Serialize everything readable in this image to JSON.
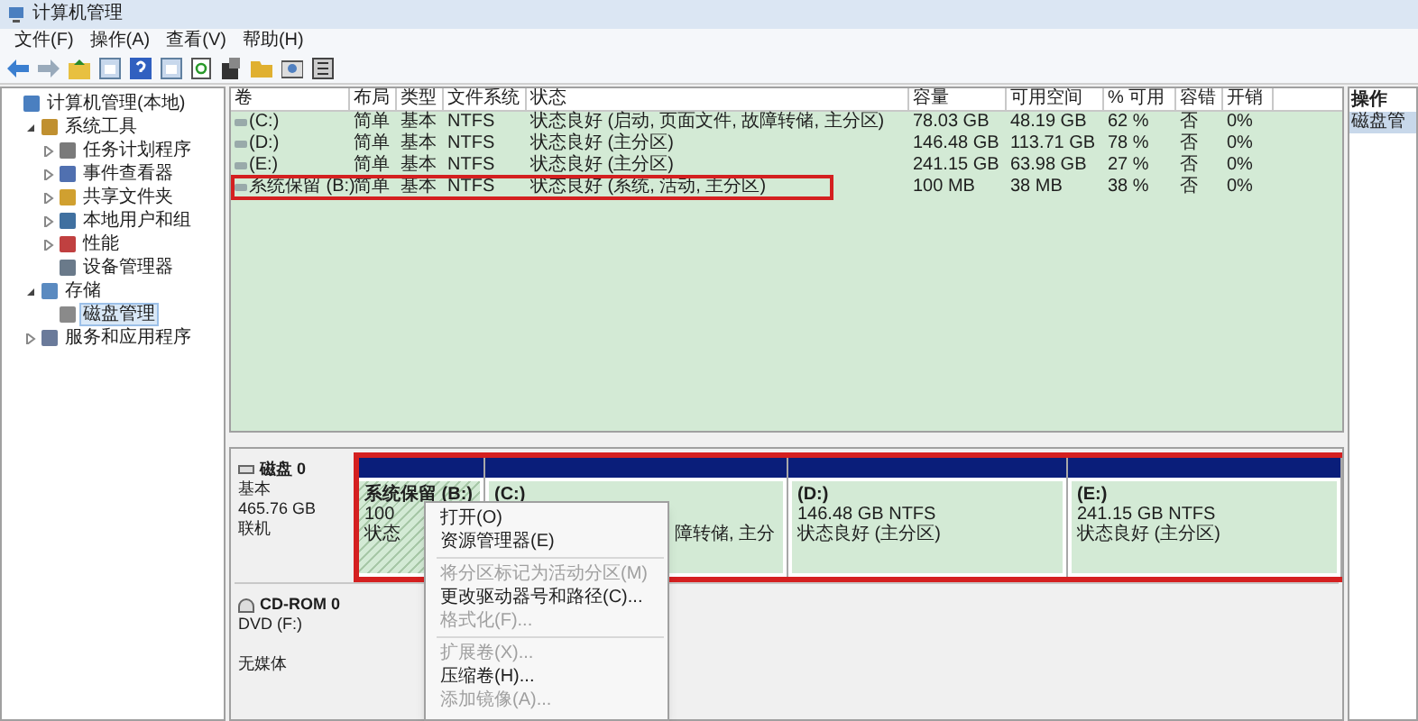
{
  "window": {
    "title": "计算机管理"
  },
  "menu": [
    "文件(F)",
    "操作(A)",
    "查看(V)",
    "帮助(H)"
  ],
  "tree": [
    {
      "label": "计算机管理(本地)",
      "selected": false,
      "children": [
        {
          "label": "系统工具",
          "expanded": true,
          "selected": false,
          "children": [
            {
              "label": "任务计划程序",
              "expanded": false,
              "selected": false
            },
            {
              "label": "事件查看器",
              "expanded": false,
              "selected": false
            },
            {
              "label": "共享文件夹",
              "expanded": false,
              "selected": false
            },
            {
              "label": "本地用户和组",
              "expanded": false,
              "selected": false
            },
            {
              "label": "性能",
              "expanded": false,
              "selected": false
            },
            {
              "label": "设备管理器",
              "selected": false
            }
          ]
        },
        {
          "label": "存储",
          "expanded": true,
          "selected": false,
          "children": [
            {
              "label": "磁盘管理",
              "selected": true
            }
          ]
        },
        {
          "label": "服务和应用程序",
          "expanded": false,
          "selected": false
        }
      ]
    }
  ],
  "volumes": {
    "columns": [
      "卷",
      "布局",
      "类型",
      "文件系统",
      "状态",
      "容量",
      "可用空间",
      "% 可用",
      "容错",
      "开销"
    ],
    "rows": [
      {
        "marked": false,
        "cells": [
          "(C:)",
          "简单",
          "基本",
          "NTFS",
          "状态良好 (启动, 页面文件, 故障转储, 主分区)",
          "78.03 GB",
          "48.19 GB",
          "62 %",
          "否",
          "0%"
        ]
      },
      {
        "marked": false,
        "cells": [
          "(D:)",
          "简单",
          "基本",
          "NTFS",
          "状态良好 (主分区)",
          "146.48 GB",
          "113.71 GB",
          "78 %",
          "否",
          "0%"
        ]
      },
      {
        "marked": false,
        "cells": [
          "(E:)",
          "简单",
          "基本",
          "NTFS",
          "状态良好 (主分区)",
          "241.15 GB",
          "63.98 GB",
          "27 %",
          "否",
          "0%"
        ]
      },
      {
        "marked": true,
        "cells": [
          "系统保留 (B:)",
          "简单",
          "基本",
          "NTFS",
          "状态良好 (系统, 活动, 主分区)",
          "100 MB",
          "38 MB",
          "38 %",
          "否",
          "0%"
        ]
      }
    ]
  },
  "disks": [
    {
      "kind": "hdd",
      "name": "磁盘 0",
      "lines": [
        "基本",
        "465.76 GB",
        "联机"
      ],
      "marked": true,
      "partitions": [
        {
          "name": "系统保留 (B:)",
          "lines": [
            "100",
            "状态"
          ],
          "hatched": true
        },
        {
          "name": "(C:)",
          "tail": "障转储, 主分",
          "hatched": false
        },
        {
          "name": "(D:)",
          "lines": [
            "146.48 GB NTFS",
            "状态良好 (主分区)"
          ],
          "hatched": false
        },
        {
          "name": "(E:)",
          "lines": [
            "241.15 GB NTFS",
            "状态良好 (主分区)"
          ],
          "hatched": false
        }
      ]
    },
    {
      "kind": "cdrom",
      "name": "CD-ROM 0",
      "lines": [
        "DVD (F:)",
        "无媒体"
      ],
      "marked": false
    }
  ],
  "context_menu": [
    {
      "kind": "item",
      "label": "打开(O)",
      "disabled": false
    },
    {
      "kind": "item",
      "label": "资源管理器(E)",
      "disabled": false
    },
    {
      "kind": "separator"
    },
    {
      "kind": "item",
      "label": "将分区标记为活动分区(M)",
      "disabled": true
    },
    {
      "kind": "item",
      "label": "更改驱动器号和路径(C)...",
      "disabled": false
    },
    {
      "kind": "item",
      "label": "格式化(F)...",
      "disabled": true
    },
    {
      "kind": "separator"
    },
    {
      "kind": "item",
      "label": "扩展卷(X)...",
      "disabled": true
    },
    {
      "kind": "item",
      "label": "压缩卷(H)...",
      "disabled": false
    },
    {
      "kind": "item",
      "label": "添加镜像(A)...",
      "disabled": true
    }
  ],
  "actions": {
    "title": "操作",
    "items": [
      {
        "label": "磁盘管",
        "selected": true
      }
    ]
  }
}
